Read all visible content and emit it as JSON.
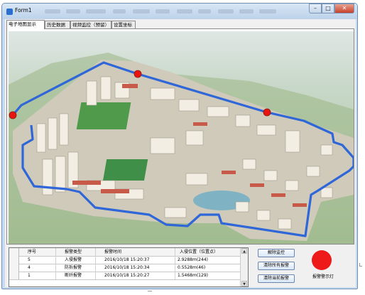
{
  "window": {
    "title": "Form1",
    "minimize_glyph": "–",
    "maximize_glyph": "□",
    "close_glyph": "✕"
  },
  "tabs": [
    {
      "label": "电子地图显示",
      "active": true
    },
    {
      "label": "历史数据",
      "active": false
    },
    {
      "label": "视频监控（预留）",
      "active": false
    },
    {
      "label": "设置坐标",
      "active": false
    }
  ],
  "alarm_table": {
    "columns": [
      "序号",
      "报警类型",
      "报警时间",
      "入侵位置（位置点）"
    ],
    "rows": [
      [
        "5",
        "入侵报警",
        "2016/10/18 15:20:37",
        "2.9288m(244)"
      ],
      [
        "4",
        "防拆报警",
        "2016/10/18 15:20:34",
        "0.5528m(46)"
      ],
      [
        "1",
        "断纤报警",
        "2016/10/18 15:20:27",
        "1.5468m(129)"
      ]
    ]
  },
  "buttons": {
    "release_monitor": "解除监控",
    "clear_all_alarms": "清除所有报警",
    "clear_current_alarm": "清除当前报警"
  },
  "alarm_lamp": {
    "label": "报警警示灯",
    "color": "#ee1a1a"
  },
  "colors": {
    "perimeter": "#2f66d8",
    "alarm_point": "#e8140f"
  }
}
